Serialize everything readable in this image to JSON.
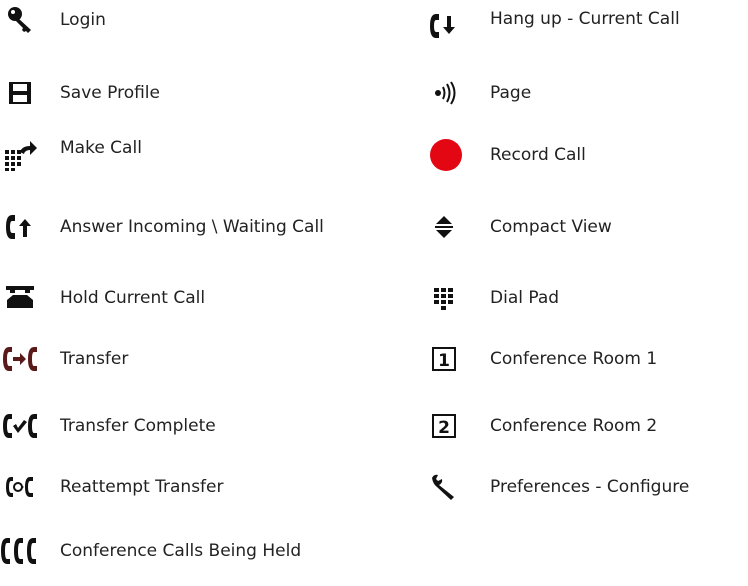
{
  "legend": {
    "left": [
      {
        "icon": "key-icon",
        "label": "Login"
      },
      {
        "icon": "floppy-disk-icon",
        "label": "Save Profile"
      },
      {
        "icon": "make-call-icon",
        "label": "Make Call"
      },
      {
        "icon": "answer-call-icon",
        "label": "Answer Incoming \\ Waiting Call"
      },
      {
        "icon": "hold-phone-icon",
        "label": "Hold Current Call"
      },
      {
        "icon": "transfer-icon",
        "label": "Transfer"
      },
      {
        "icon": "transfer-complete-icon",
        "label": "Transfer Complete"
      },
      {
        "icon": "reattempt-transfer-icon",
        "label": "Reattempt Transfer"
      },
      {
        "icon": "conference-calls-icon",
        "label": "Conference Calls Being Held"
      }
    ],
    "right": [
      {
        "icon": "hang-up-icon",
        "label": "Hang up - Current Call"
      },
      {
        "icon": "page-broadcast-icon",
        "label": "Page"
      },
      {
        "icon": "record-dot-icon",
        "label": "Record Call"
      },
      {
        "icon": "compact-view-icon",
        "label": "Compact View"
      },
      {
        "icon": "dial-pad-icon",
        "label": "Dial Pad"
      },
      {
        "icon": "conference-room-1-icon",
        "label": "Conference Room 1",
        "badge": "1"
      },
      {
        "icon": "conference-room-2-icon",
        "label": "Conference Room 2",
        "badge": "2"
      },
      {
        "icon": "wrench-icon",
        "label": "Preferences - Configure"
      }
    ]
  },
  "colors": {
    "text": "#222222",
    "icon_black": "#111111",
    "transfer_brown": "#5a1a1a",
    "record_red": "#e30613"
  }
}
